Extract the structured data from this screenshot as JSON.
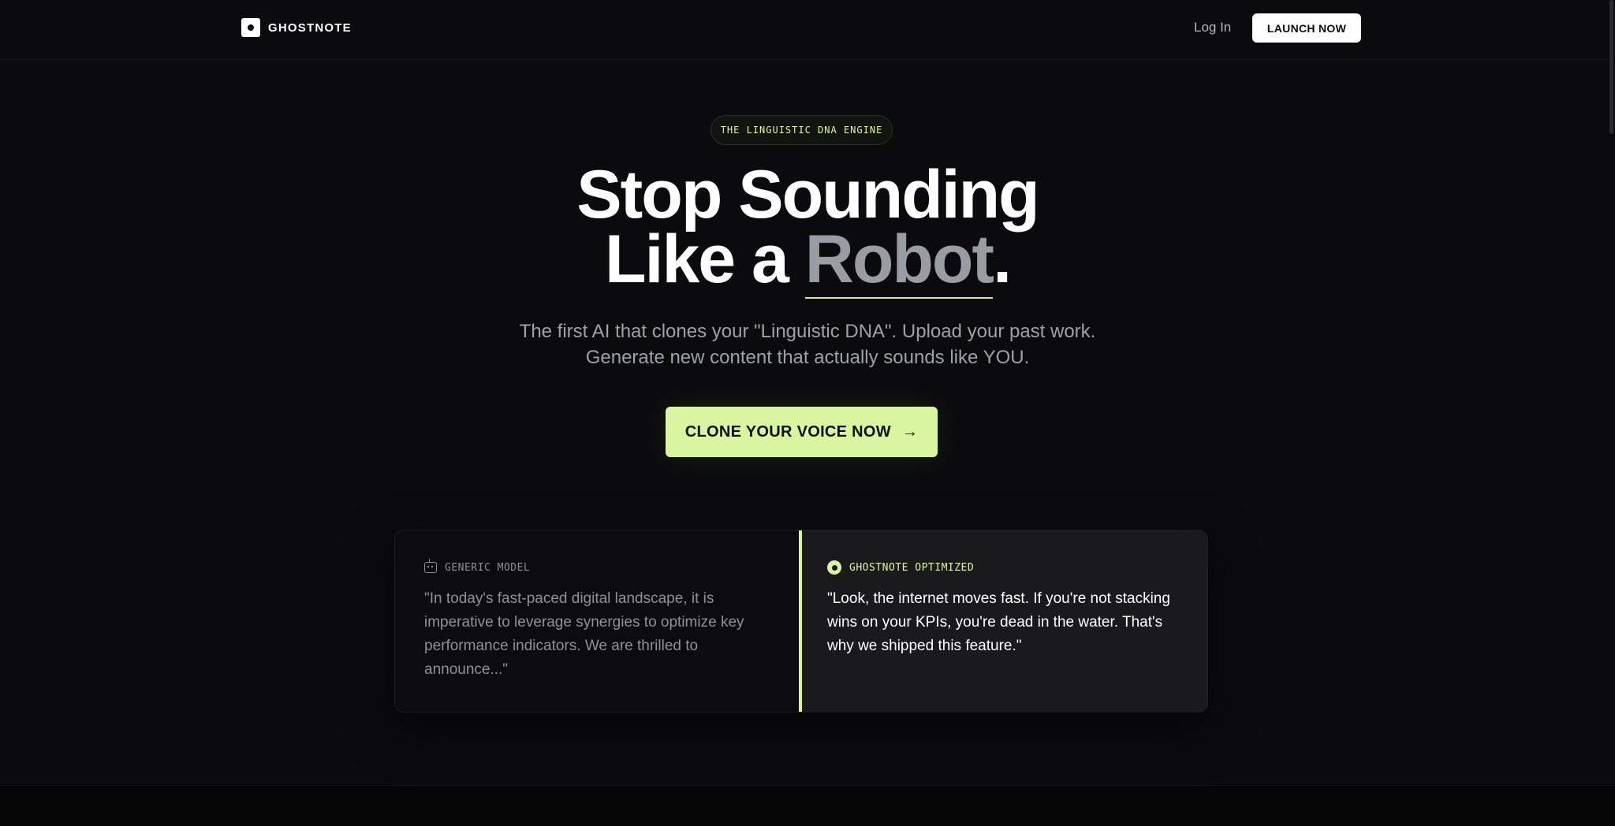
{
  "nav": {
    "brand": "GHOSTNOTE",
    "login_label": "Log In",
    "launch_label": "LAUNCH NOW"
  },
  "hero": {
    "badge": "THE LINGUISTIC DNA ENGINE",
    "headline_line1": "Stop Sounding",
    "headline_line2_prefix": "Like a ",
    "headline_highlight": "Robot",
    "headline_suffix": ".",
    "subtext_line1": "The first AI that clones your \"Linguistic DNA\". Upload your past work.",
    "subtext_line2": "Generate new content that actually sounds like YOU.",
    "cta_label": "CLONE YOUR VOICE NOW",
    "cta_arrow": "→"
  },
  "comparison": {
    "generic": {
      "label": "GENERIC MODEL",
      "icon": "robot-icon",
      "quote": "\"In today's fast-paced digital landscape, it is imperative to leverage synergies to optimize key performance indicators. We are thrilled to announce...\""
    },
    "ghostnote": {
      "label": "GHOSTNOTE OPTIMIZED",
      "icon": "ghostnote-dot-icon",
      "quote": "\"Look, the internet moves fast. If you're not stacking wins on your KPIs, you're dead in the water. That's why we shipped this feature.\""
    }
  },
  "colors": {
    "background": "#0b0b0d",
    "accent": "#daf5a0",
    "panel_dark": "#1a1a1d"
  }
}
